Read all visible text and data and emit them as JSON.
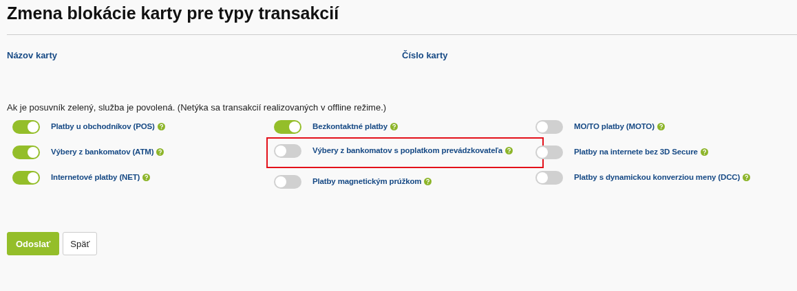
{
  "title": "Zmena blokácie karty pre typy transakcií",
  "card_fields": [
    {
      "label": "Názov karty"
    },
    {
      "label": "Číslo karty"
    }
  ],
  "info": "Ak je posuvník zelený, služba je povolená. (Netýka sa transakcií realizovaných v offline režime.)",
  "columns": [
    [
      {
        "label": "Platby u obchodníkov (POS)",
        "on": true,
        "highlighted": false
      },
      {
        "label": "Výbery z bankomatov (ATM)",
        "on": true,
        "highlighted": false
      },
      {
        "label": "Internetové platby (NET)",
        "on": true,
        "highlighted": false
      }
    ],
    [
      {
        "label": "Bezkontaktné platby",
        "on": true,
        "highlighted": false
      },
      {
        "label": "Výbery z bankomatov s poplatkom prevádzkovateľa",
        "on": false,
        "highlighted": true
      },
      {
        "label": "Platby magnetickým prúžkom",
        "on": false,
        "highlighted": false
      }
    ],
    [
      {
        "label": "MO/TO platby (MOTO)",
        "on": false,
        "highlighted": false
      },
      {
        "label": "Platby na internete bez 3D Secure",
        "on": false,
        "highlighted": false
      },
      {
        "label": "Platby s dynamickou konverziou meny (DCC)",
        "on": false,
        "highlighted": false
      }
    ]
  ],
  "buttons": [
    {
      "label": "Odoslať",
      "kind": "primary"
    },
    {
      "label": "Späť",
      "kind": "secondary"
    }
  ]
}
